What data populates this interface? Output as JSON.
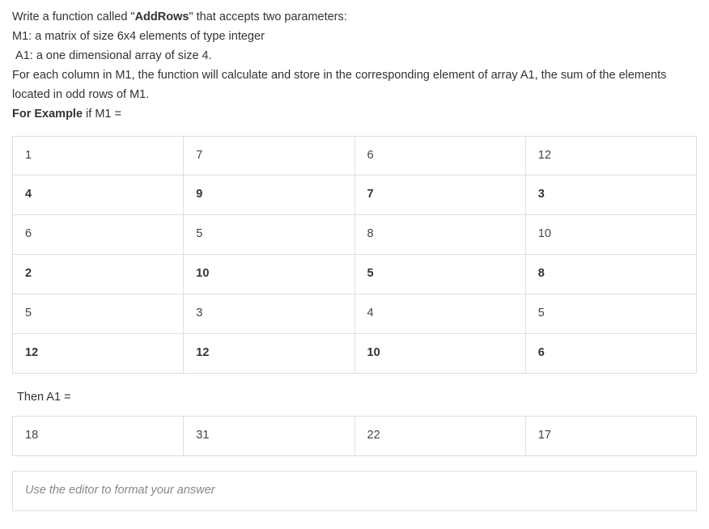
{
  "prompt": {
    "line1_a": "Write a function called \"",
    "fn_name": "AddRows",
    "line1_b": "\" that accepts two parameters:",
    "line2": "M1: a matrix of size 6x4 elements of type integer",
    "line3": " A1: a one dimensional array of size 4.",
    "line4": "For each column in M1, the function will calculate and store in the corresponding element of array A1, the sum of the elements located in odd rows of M1.",
    "line5_bold": "For Example",
    "line5_tail": " if M1 ="
  },
  "matrix_m1": {
    "rows": [
      {
        "bold": false,
        "cells": [
          "1",
          "7",
          "6",
          "12"
        ]
      },
      {
        "bold": true,
        "cells": [
          "4",
          "9",
          "7",
          "3"
        ]
      },
      {
        "bold": false,
        "cells": [
          "6",
          "5",
          "8",
          "10"
        ]
      },
      {
        "bold": true,
        "cells": [
          "2",
          "10",
          "5",
          "8"
        ]
      },
      {
        "bold": false,
        "cells": [
          "5",
          "3",
          "4",
          "5"
        ]
      },
      {
        "bold": true,
        "cells": [
          "12",
          "12",
          "10",
          "6"
        ]
      }
    ]
  },
  "then_label": " Then A1 =",
  "array_a1": {
    "cells": [
      "18",
      "31",
      "22",
      "17"
    ]
  },
  "answer_placeholder": "Use the editor to format your answer"
}
